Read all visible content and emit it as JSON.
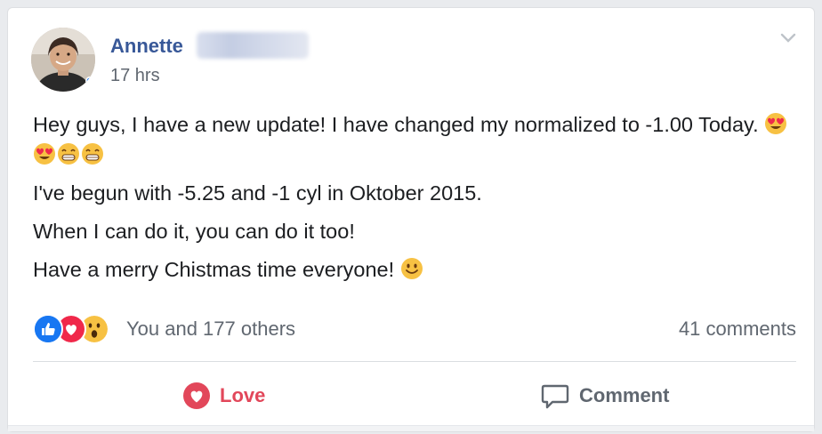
{
  "post": {
    "author": "Annette",
    "time": "17 hrs",
    "paragraphs": [
      "Hey guys, I have a new update! I have changed my normalized to -1.00 Today.",
      "I've begun with -5.25 and -1 cyl in Oktober 2015.",
      "When I can do it, you can do it too!",
      "Have a merry Chistmas time everyone!"
    ],
    "reactions_text": "You and 177 others",
    "comments_text": "41 comments"
  },
  "actions": {
    "love_label": "Love",
    "comment_label": "Comment"
  },
  "icons": {
    "menu": "chevron-down-icon",
    "reactions": [
      "like-icon",
      "heart-icon",
      "wow-icon"
    ],
    "emojis_p1": [
      "heart-eyes-emoji",
      "heart-eyes-emoji",
      "grin-emoji",
      "grin-emoji"
    ],
    "emoji_p4": "smile-emoji",
    "love": "heart-icon",
    "comment": "speech-bubble-icon"
  },
  "colors": {
    "author_link": "#385898",
    "love_red": "#e2475a",
    "like_blue": "#1877f2",
    "secondary_text": "#606770"
  }
}
